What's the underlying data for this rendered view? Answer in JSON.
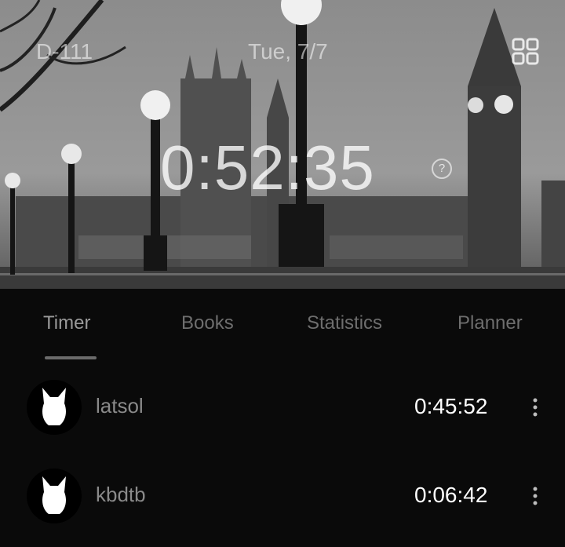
{
  "header": {
    "dday": "D-111",
    "date": "Tue, 7/7",
    "grid_icon": "grid-icon"
  },
  "timer": {
    "value": "0:52:35",
    "help_label": "?"
  },
  "tabs": [
    {
      "label": "Timer",
      "active": true
    },
    {
      "label": "Books",
      "active": false
    },
    {
      "label": "Statistics",
      "active": false
    },
    {
      "label": "Planner",
      "active": false
    }
  ],
  "members": [
    {
      "name": "latsol",
      "time": "0:45:52",
      "avatar_icon": "cat-avatar-icon"
    },
    {
      "name": "kbdtb",
      "time": "0:06:42",
      "avatar_icon": "cat-avatar-icon"
    }
  ],
  "colors": {
    "background": "#0a0a0a",
    "tab_active": "#9a9a9a",
    "tab_inactive": "#6e6e6e",
    "time_text": "#ffffff"
  }
}
